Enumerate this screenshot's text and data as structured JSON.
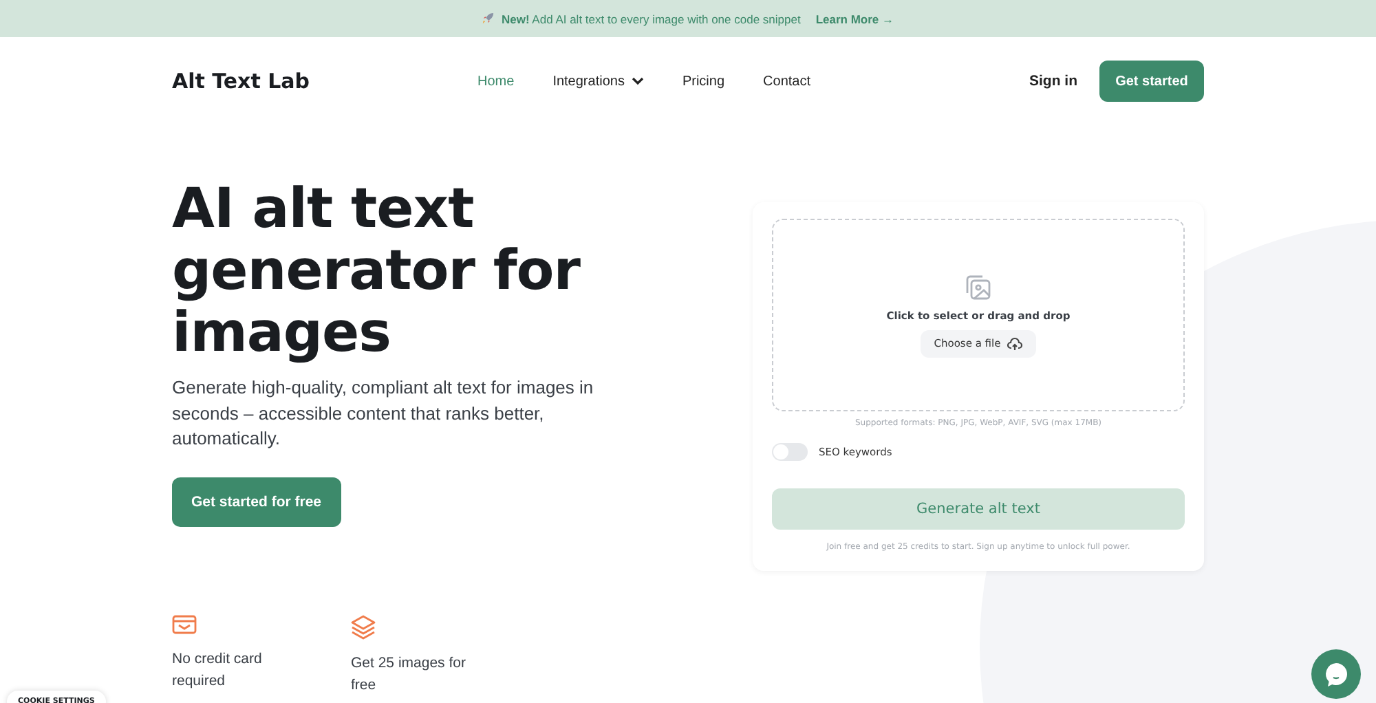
{
  "banner": {
    "badge": "New!",
    "text": "Add AI alt text to every image with one code snippet",
    "link": "Learn More →"
  },
  "nav": {
    "logo": "Alt Text Lab",
    "links": [
      {
        "label": "Home",
        "selected": true,
        "dropdown": false
      },
      {
        "label": "Integrations",
        "selected": false,
        "dropdown": true
      },
      {
        "label": "Pricing",
        "selected": false,
        "dropdown": false
      },
      {
        "label": "Contact",
        "selected": false,
        "dropdown": false
      }
    ],
    "sign_in": "Sign in",
    "cta": "Get started"
  },
  "hero": {
    "title": "AI alt text generator for images",
    "subtitle": "Generate high-quality, compliant alt text for images in seconds – accessible content that ranks better, automatically.",
    "cta": "Get started for free",
    "features": [
      {
        "kind": "card",
        "text": "No credit card required"
      },
      {
        "kind": "layers",
        "text": "Get 25 images for free"
      }
    ]
  },
  "uploader": {
    "drop_text": "Click to select or drag and drop",
    "choose": "Choose a file",
    "formats": "Supported formats: PNG, JPG, WebP, AVIF, SVG (max 17MB)",
    "seo": {
      "label": "SEO keywords",
      "on": false
    },
    "generate": "Generate alt text",
    "note": "Join free and get 25 credits to start. Sign up anytime to unlock full power."
  },
  "cookie": "COOKIE SETTINGS"
}
